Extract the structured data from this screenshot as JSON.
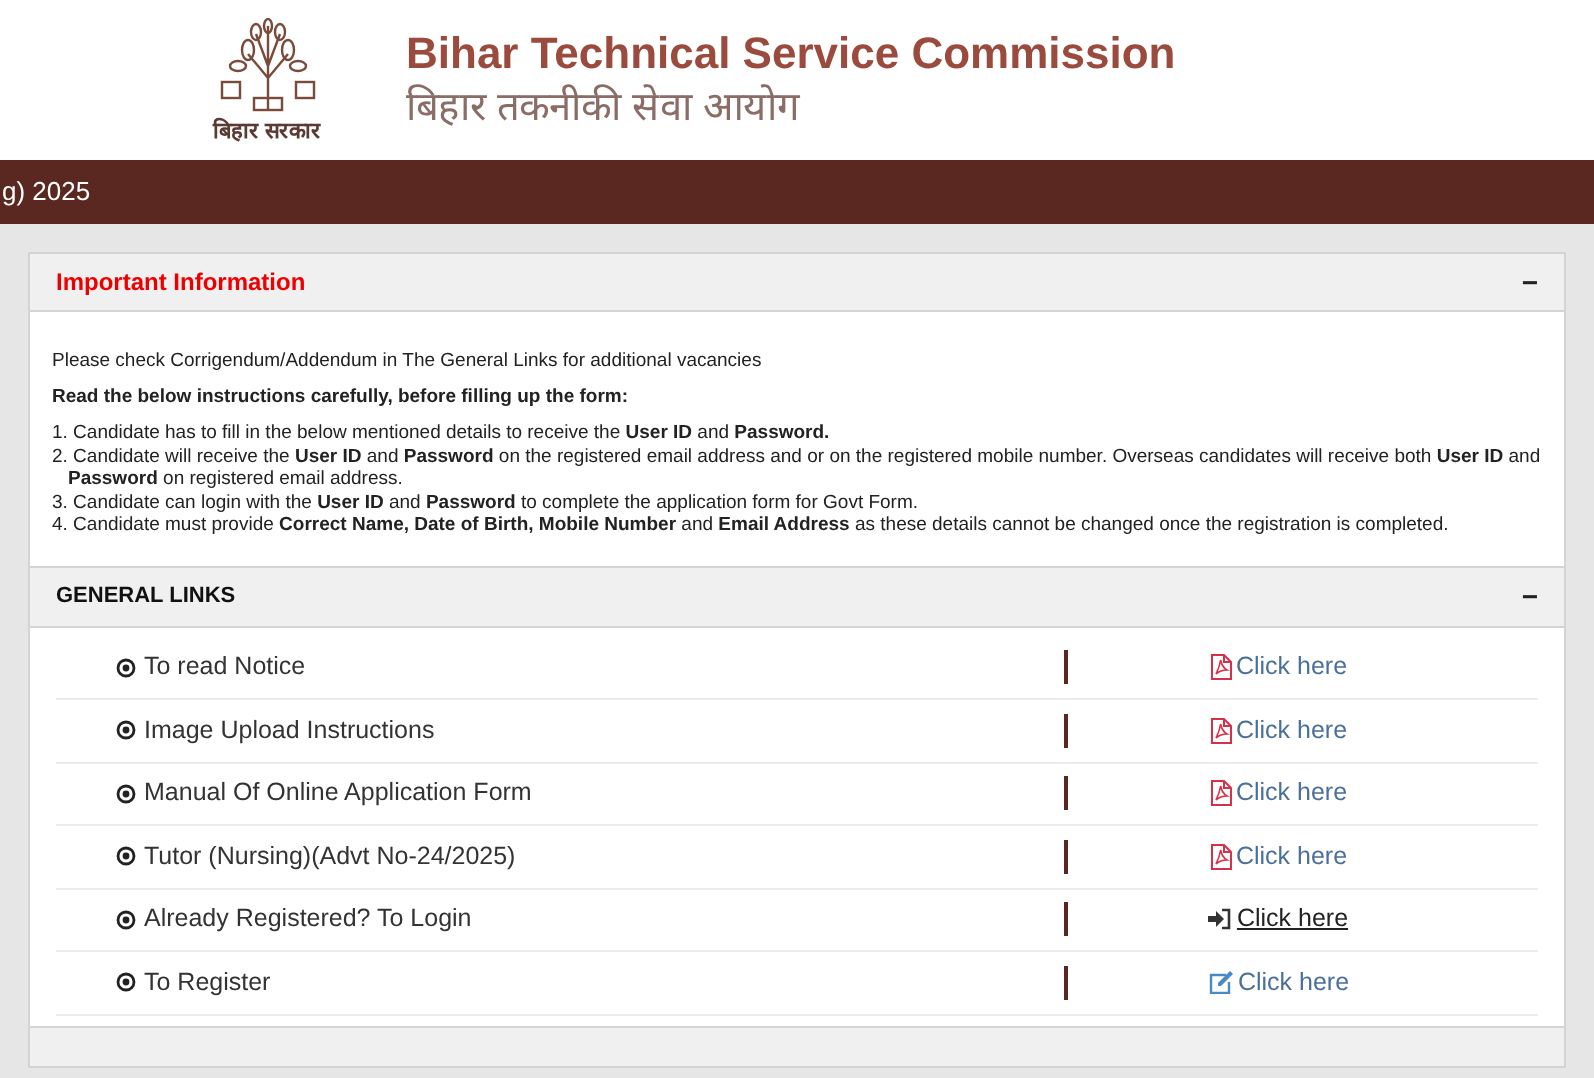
{
  "header": {
    "logo_caption": "बिहार सरकार",
    "title": "Bihar Technical Service Commission",
    "subtitle": "बिहार तकनीकी सेवा आयोग"
  },
  "banner": {
    "text": "g) 2025"
  },
  "important": {
    "title": "Important Information",
    "toggle": "−",
    "notice": "Please check Corrigendum/Addendum in The General Links for additional vacancies",
    "lead": "Read the below instructions carefully, before filling up the form:",
    "items": [
      "1. Candidate has to fill in the below mentioned details to receive the **User ID** and **Password.**",
      "2. Candidate will receive the **User ID** and **Password** on the registered email address and or on the registered mobile number. Overseas candidates will receive both **User ID** and **Password** on registered email address.",
      "3. Candidate can login with the **User ID** and **Password** to complete the application form for Govt Form.",
      "4. Candidate must provide **Correct Name, Date of Birth, Mobile Number** and **Email Address** as these details cannot be changed once the registration is completed."
    ]
  },
  "general_links": {
    "title": "GENERAL LINKS",
    "toggle": "−",
    "rows": [
      {
        "label": "To read Notice",
        "link": "Click here",
        "kind": "pdf",
        "hovered": false
      },
      {
        "label": "Image Upload Instructions",
        "link": "Click here",
        "kind": "pdf",
        "hovered": false
      },
      {
        "label": "Manual Of Online Application Form",
        "link": "Click here",
        "kind": "pdf",
        "hovered": false
      },
      {
        "label": "Tutor (Nursing)(Advt No-24/2025)",
        "link": "Click here",
        "kind": "pdf",
        "hovered": false
      },
      {
        "label": "Already Registered? To Login",
        "link": "Click here",
        "kind": "login",
        "hovered": true
      },
      {
        "label": "To Register",
        "link": "Click here",
        "kind": "edit",
        "hovered": false
      }
    ]
  }
}
